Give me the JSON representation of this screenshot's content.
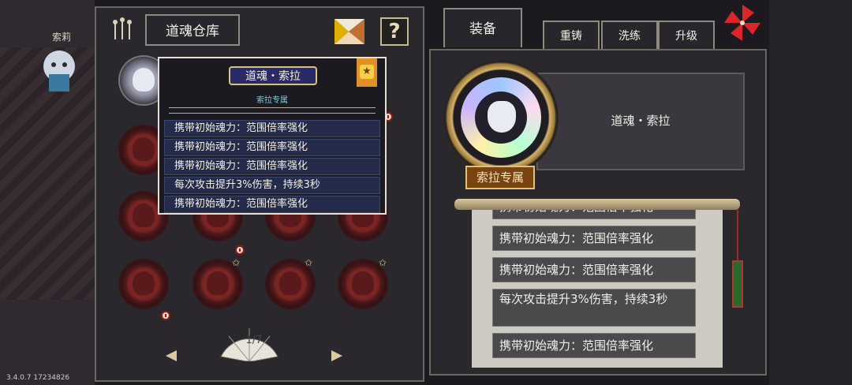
{
  "version": "3.4.0.7 17234826",
  "character_name": "索莉",
  "left_panel": {
    "title": "道魂仓库",
    "help_label": "?",
    "page_indicator": "1/7"
  },
  "tooltip": {
    "name": "道魂・索拉",
    "exclusive_label": "索拉专属",
    "star_glyph": "★",
    "effects": [
      "携带初始魂力：范围倍率强化",
      "携带初始魂力：范围倍率强化",
      "携带初始魂力：范围倍率强化",
      "每次攻击提升3%伤害，持续3秒",
      "携带初始魂力：范围倍率强化"
    ]
  },
  "right_panel": {
    "tabs": {
      "equip": "装备",
      "reforge": "重铸",
      "refine": "洗练",
      "upgrade": "升级"
    },
    "item_name": "道魂・索拉",
    "exclusive_banner": "索拉专属",
    "effects": [
      "携带初始魂力：范围倍率强化",
      "携带初始魂力：范围倍率强化",
      "携带初始魂力：范围倍率强化",
      "每次攻击提升3%伤害，持续3秒",
      "携带初始魂力：范围倍率强化"
    ]
  },
  "colors": {
    "panel_bg": "#2b282d",
    "tooltip_row": "#242c4a",
    "soul_red": "#7a2424",
    "gold": "#d6b26a",
    "pinwheel_red": "#d8262b"
  }
}
